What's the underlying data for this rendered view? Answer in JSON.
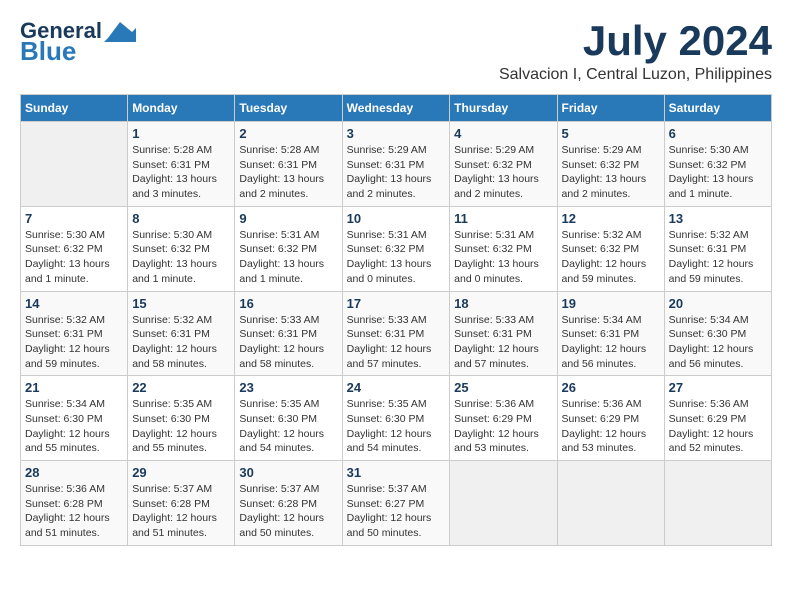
{
  "header": {
    "logo_line1": "General",
    "logo_line2": "Blue",
    "month": "July 2024",
    "location": "Salvacion I, Central Luzon, Philippines"
  },
  "weekdays": [
    "Sunday",
    "Monday",
    "Tuesday",
    "Wednesday",
    "Thursday",
    "Friday",
    "Saturday"
  ],
  "weeks": [
    [
      {
        "day": "",
        "info": ""
      },
      {
        "day": "1",
        "info": "Sunrise: 5:28 AM\nSunset: 6:31 PM\nDaylight: 13 hours\nand 3 minutes."
      },
      {
        "day": "2",
        "info": "Sunrise: 5:28 AM\nSunset: 6:31 PM\nDaylight: 13 hours\nand 2 minutes."
      },
      {
        "day": "3",
        "info": "Sunrise: 5:29 AM\nSunset: 6:31 PM\nDaylight: 13 hours\nand 2 minutes."
      },
      {
        "day": "4",
        "info": "Sunrise: 5:29 AM\nSunset: 6:32 PM\nDaylight: 13 hours\nand 2 minutes."
      },
      {
        "day": "5",
        "info": "Sunrise: 5:29 AM\nSunset: 6:32 PM\nDaylight: 13 hours\nand 2 minutes."
      },
      {
        "day": "6",
        "info": "Sunrise: 5:30 AM\nSunset: 6:32 PM\nDaylight: 13 hours\nand 1 minute."
      }
    ],
    [
      {
        "day": "7",
        "info": "Sunrise: 5:30 AM\nSunset: 6:32 PM\nDaylight: 13 hours\nand 1 minute."
      },
      {
        "day": "8",
        "info": "Sunrise: 5:30 AM\nSunset: 6:32 PM\nDaylight: 13 hours\nand 1 minute."
      },
      {
        "day": "9",
        "info": "Sunrise: 5:31 AM\nSunset: 6:32 PM\nDaylight: 13 hours\nand 1 minute."
      },
      {
        "day": "10",
        "info": "Sunrise: 5:31 AM\nSunset: 6:32 PM\nDaylight: 13 hours\nand 0 minutes."
      },
      {
        "day": "11",
        "info": "Sunrise: 5:31 AM\nSunset: 6:32 PM\nDaylight: 13 hours\nand 0 minutes."
      },
      {
        "day": "12",
        "info": "Sunrise: 5:32 AM\nSunset: 6:32 PM\nDaylight: 12 hours\nand 59 minutes."
      },
      {
        "day": "13",
        "info": "Sunrise: 5:32 AM\nSunset: 6:31 PM\nDaylight: 12 hours\nand 59 minutes."
      }
    ],
    [
      {
        "day": "14",
        "info": "Sunrise: 5:32 AM\nSunset: 6:31 PM\nDaylight: 12 hours\nand 59 minutes."
      },
      {
        "day": "15",
        "info": "Sunrise: 5:32 AM\nSunset: 6:31 PM\nDaylight: 12 hours\nand 58 minutes."
      },
      {
        "day": "16",
        "info": "Sunrise: 5:33 AM\nSunset: 6:31 PM\nDaylight: 12 hours\nand 58 minutes."
      },
      {
        "day": "17",
        "info": "Sunrise: 5:33 AM\nSunset: 6:31 PM\nDaylight: 12 hours\nand 57 minutes."
      },
      {
        "day": "18",
        "info": "Sunrise: 5:33 AM\nSunset: 6:31 PM\nDaylight: 12 hours\nand 57 minutes."
      },
      {
        "day": "19",
        "info": "Sunrise: 5:34 AM\nSunset: 6:31 PM\nDaylight: 12 hours\nand 56 minutes."
      },
      {
        "day": "20",
        "info": "Sunrise: 5:34 AM\nSunset: 6:30 PM\nDaylight: 12 hours\nand 56 minutes."
      }
    ],
    [
      {
        "day": "21",
        "info": "Sunrise: 5:34 AM\nSunset: 6:30 PM\nDaylight: 12 hours\nand 55 minutes."
      },
      {
        "day": "22",
        "info": "Sunrise: 5:35 AM\nSunset: 6:30 PM\nDaylight: 12 hours\nand 55 minutes."
      },
      {
        "day": "23",
        "info": "Sunrise: 5:35 AM\nSunset: 6:30 PM\nDaylight: 12 hours\nand 54 minutes."
      },
      {
        "day": "24",
        "info": "Sunrise: 5:35 AM\nSunset: 6:30 PM\nDaylight: 12 hours\nand 54 minutes."
      },
      {
        "day": "25",
        "info": "Sunrise: 5:36 AM\nSunset: 6:29 PM\nDaylight: 12 hours\nand 53 minutes."
      },
      {
        "day": "26",
        "info": "Sunrise: 5:36 AM\nSunset: 6:29 PM\nDaylight: 12 hours\nand 53 minutes."
      },
      {
        "day": "27",
        "info": "Sunrise: 5:36 AM\nSunset: 6:29 PM\nDaylight: 12 hours\nand 52 minutes."
      }
    ],
    [
      {
        "day": "28",
        "info": "Sunrise: 5:36 AM\nSunset: 6:28 PM\nDaylight: 12 hours\nand 51 minutes."
      },
      {
        "day": "29",
        "info": "Sunrise: 5:37 AM\nSunset: 6:28 PM\nDaylight: 12 hours\nand 51 minutes."
      },
      {
        "day": "30",
        "info": "Sunrise: 5:37 AM\nSunset: 6:28 PM\nDaylight: 12 hours\nand 50 minutes."
      },
      {
        "day": "31",
        "info": "Sunrise: 5:37 AM\nSunset: 6:27 PM\nDaylight: 12 hours\nand 50 minutes."
      },
      {
        "day": "",
        "info": ""
      },
      {
        "day": "",
        "info": ""
      },
      {
        "day": "",
        "info": ""
      }
    ]
  ]
}
